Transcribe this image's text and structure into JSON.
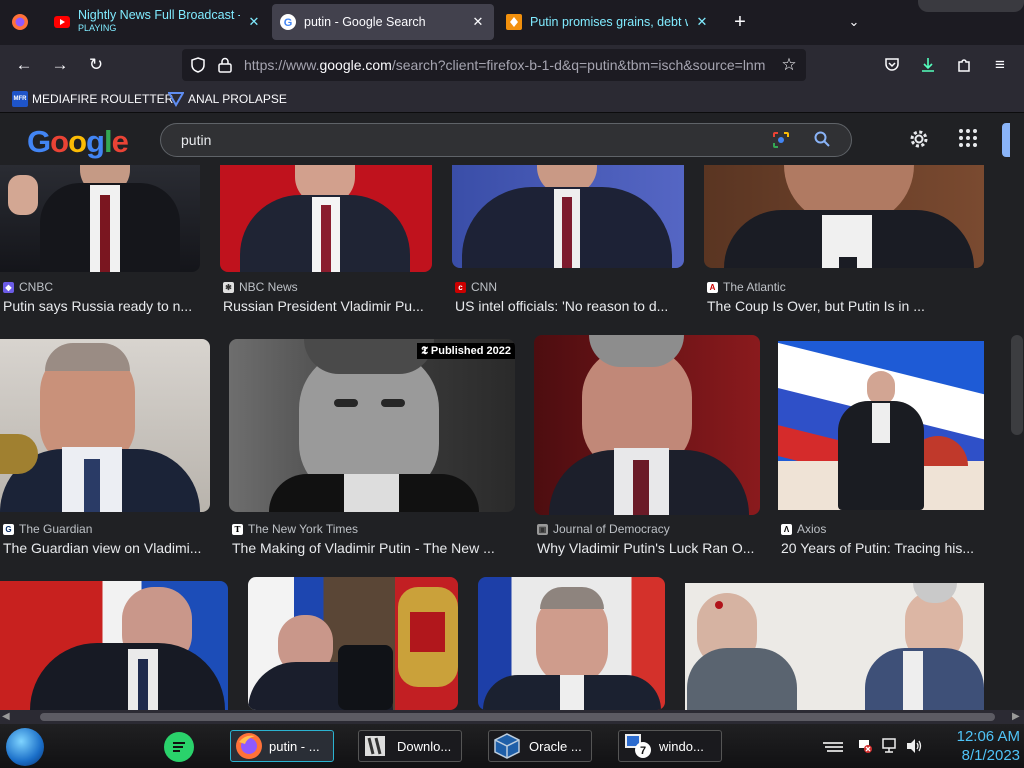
{
  "browser": {
    "tabs": [
      {
        "title": "Nightly News Full Broadcast - A",
        "subtitle": "PLAYING",
        "icon": "youtube-icon",
        "active": false
      },
      {
        "title": "putin - Google Search",
        "icon": "google-icon",
        "active": true
      },
      {
        "title": "Putin promises grains, debt wri",
        "icon": "pocket-favicon-icon",
        "active": false
      }
    ],
    "url_prefix": "https://www.",
    "url_domain": "google.com",
    "url_rest": "/search?client=firefox-b-1-d&q=putin&tbm=isch&source=lnm",
    "bookmarks": [
      {
        "label": "MEDIAFIRE ROULETTER",
        "icon_text": "MFR"
      },
      {
        "label": "ANAL PROLAPSE"
      }
    ]
  },
  "google": {
    "logo": "Google",
    "query": "putin"
  },
  "results": [
    {
      "source": "CNBC",
      "caption": "Putin says Russia ready to n...",
      "tag": ""
    },
    {
      "source": "NBC News",
      "caption": "Russian President Vladimir Pu...",
      "tag": ""
    },
    {
      "source": "CNN",
      "caption": "US intel officials: 'No reason to d...",
      "tag": ""
    },
    {
      "source": "The Atlantic",
      "caption": "The Coup Is Over, but Putin Is in ...",
      "tag": ""
    },
    {
      "source": "The Guardian",
      "caption": "The Guardian view on Vladimi...",
      "tag": ""
    },
    {
      "source": "The New York Times",
      "caption": "The Making of Vladimir Putin - The New ...",
      "tag": "Published 2022"
    },
    {
      "source": "Journal of Democracy",
      "caption": "Why Vladimir Putin's Luck Ran O...",
      "tag": ""
    },
    {
      "source": "Axios",
      "caption": "20 Years of Putin: Tracing his...",
      "tag": ""
    },
    {
      "source": "",
      "caption": "",
      "tag": ""
    },
    {
      "source": "",
      "caption": "",
      "tag": ""
    },
    {
      "source": "",
      "caption": "",
      "tag": ""
    },
    {
      "source": "",
      "caption": "",
      "tag": ""
    }
  ],
  "taskbar": {
    "items": [
      {
        "label": "putin - ...",
        "icon": "firefox-icon"
      },
      {
        "label": "Downlo...",
        "icon": "downloads-icon"
      },
      {
        "label": "Oracle ...",
        "icon": "virtualbox-icon"
      },
      {
        "label": "windo...",
        "icon": "windows-7-icon"
      }
    ],
    "time": "12:06 AM",
    "date": "8/1/2023"
  },
  "colors": {
    "youtube_red": "#ff0000",
    "google_blue": "#4285f4",
    "google_red": "#ea4335",
    "google_yellow": "#fbbc05",
    "google_green": "#34a853",
    "clock": "#4fc3f7",
    "tab_active": "#42414d"
  }
}
